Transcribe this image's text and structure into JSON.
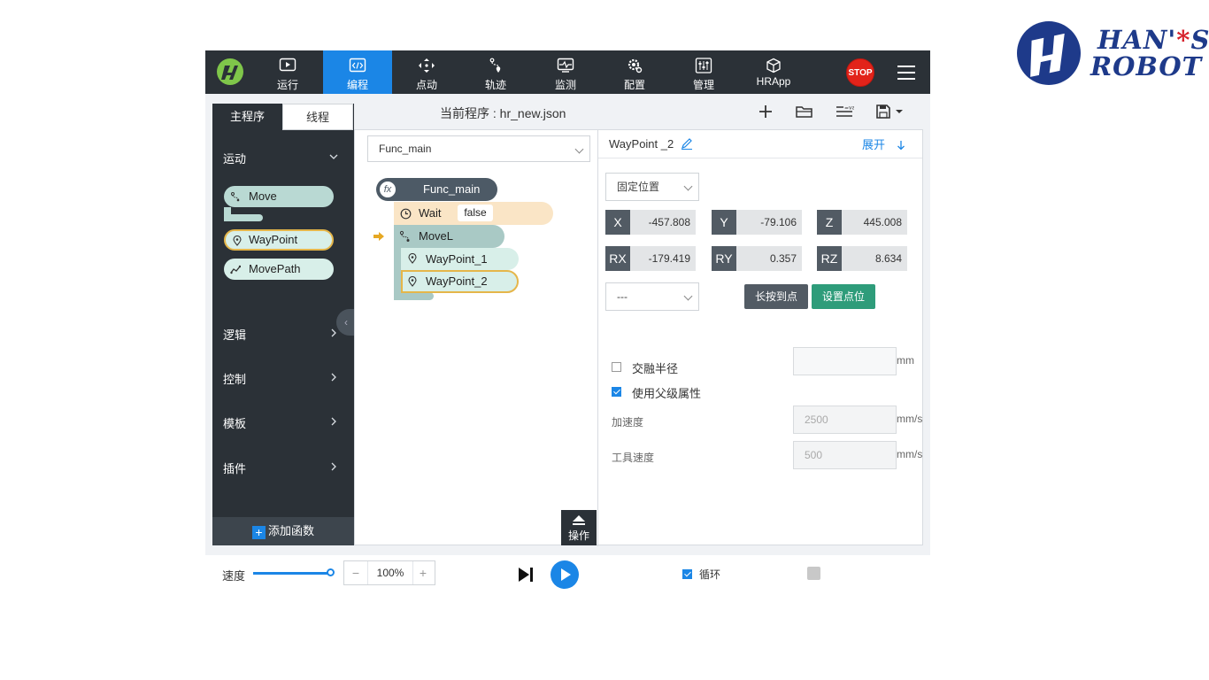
{
  "brand": {
    "line1": "HAN'S",
    "line1_a": "HAN'",
    "line1_star": "*",
    "line1_b": "S",
    "line2": "ROBOT"
  },
  "nav": {
    "items": [
      {
        "label": "运行",
        "icon": "play-screen-icon"
      },
      {
        "label": "编程",
        "icon": "code-icon",
        "active": true
      },
      {
        "label": "点动",
        "icon": "move-arrows-icon"
      },
      {
        "label": "轨迹",
        "icon": "trajectory-icon"
      },
      {
        "label": "监测",
        "icon": "monitor-icon"
      },
      {
        "label": "配置",
        "icon": "gear-config-icon"
      },
      {
        "label": "管理",
        "icon": "sliders-icon"
      },
      {
        "label": "HRApp",
        "icon": "cube-icon"
      }
    ],
    "stop_label": "STOP",
    "accent": "#1b86e6"
  },
  "left": {
    "tabs": [
      "主程序",
      "线程"
    ],
    "categories": {
      "motion": "运动",
      "logic": "逻辑",
      "control": "控制",
      "template": "模板",
      "plugin": "插件"
    },
    "blocks": {
      "move": "Move",
      "waypoint": "WayPoint",
      "movepath": "MovePath"
    },
    "add_function": "添加函数"
  },
  "program": {
    "title": "当前程序 : hr_new.json",
    "function_select": "Func_main",
    "tree": {
      "func": "Func_main",
      "func_badge": "fx",
      "wait": "Wait",
      "wait_value": "false",
      "movel": "MoveL",
      "wp1": "WayPoint_1",
      "wp2": "WayPoint_2"
    },
    "ops_label": "操作"
  },
  "props": {
    "title": "WayPoint _2",
    "expand": "展开",
    "position_type": "固定位置",
    "coords": [
      {
        "k": "X",
        "v": "-457.808"
      },
      {
        "k": "Y",
        "v": "-79.106"
      },
      {
        "k": "Z",
        "v": "445.008"
      },
      {
        "k": "RX",
        "v": "-179.419"
      },
      {
        "k": "RY",
        "v": "0.357"
      },
      {
        "k": "RZ",
        "v": "8.634"
      }
    ],
    "second_select": "---",
    "btn_hold": "长按到点",
    "btn_set": "设置点位",
    "blend_label": "交融半径",
    "blend_value": "",
    "blend_unit": "mm",
    "inherit_label": "使用父级属性",
    "accel_label": "加速度",
    "accel_value": "2500",
    "accel_unit": "mm/s",
    "tool_speed_label": "工具速度",
    "tool_speed_value": "500",
    "tool_speed_unit": "mm/s"
  },
  "bottom": {
    "speed_label": "速度",
    "speed_fraction": 1.0,
    "minus": "−",
    "speed_value": "100%",
    "plus": "+",
    "loop_label": "循环"
  }
}
